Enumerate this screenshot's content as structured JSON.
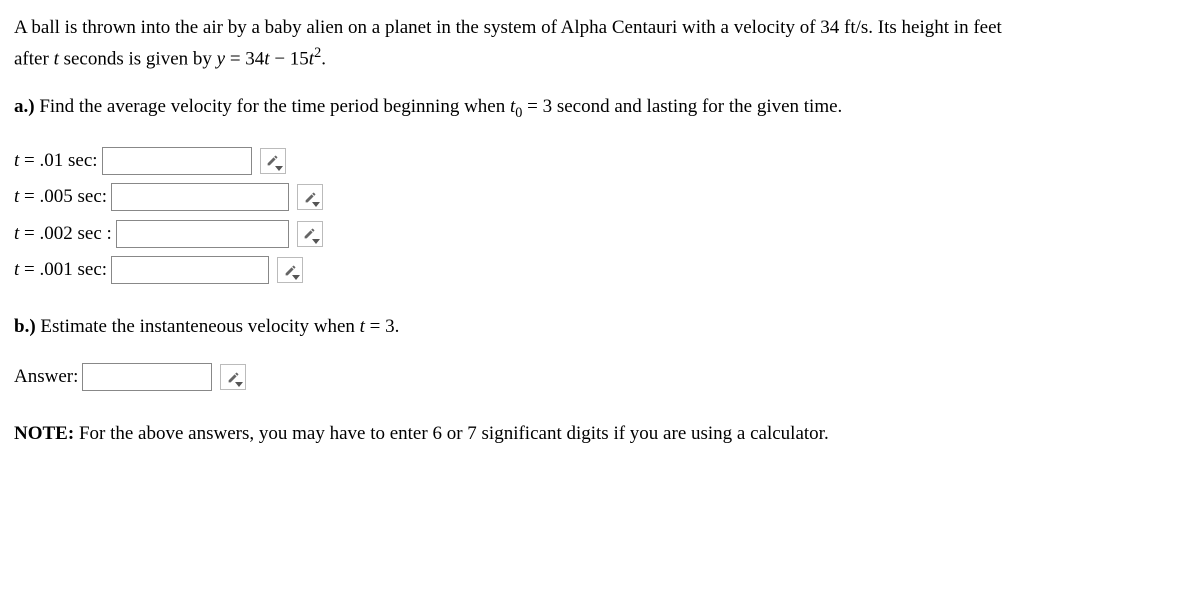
{
  "intro": {
    "line1_prefix": "A ball is thrown into the air by a baby alien on a planet in the system of Alpha Centauri with a velocity of 34 ft/s. Its height in feet",
    "line2_prefix": "after ",
    "line2_mid": " seconds is given by ",
    "equation_lhs": "y",
    "equation_eq": " = 34",
    "equation_t": "t",
    "equation_minus": " − 15",
    "equation_t2": "t",
    "equation_exp": "2",
    "equation_end": "."
  },
  "partA": {
    "label": "a.)",
    "text_before_t0": " Find the average velocity for the time period beginning when ",
    "t0_var": "t",
    "t0_sub": "0",
    "t0_after": " = 3 second and lasting for the given time."
  },
  "rows": [
    {
      "label_var": "t",
      "label_rest": " = .01 sec:"
    },
    {
      "label_var": "t",
      "label_rest": " = .005 sec:"
    },
    {
      "label_var": "t",
      "label_rest": " = .002 sec :"
    },
    {
      "label_var": "t",
      "label_rest": " = .001 sec:"
    }
  ],
  "partB": {
    "label": "b.)",
    "text_before": " Estimate the instanteneous velocity when ",
    "t_var": "t",
    "t_after": " = 3."
  },
  "answer_label": "Answer:",
  "note": {
    "bold": "NOTE:",
    "rest": " For the above answers, you may have to enter 6 or 7 significant digits if you are using a calculator."
  }
}
